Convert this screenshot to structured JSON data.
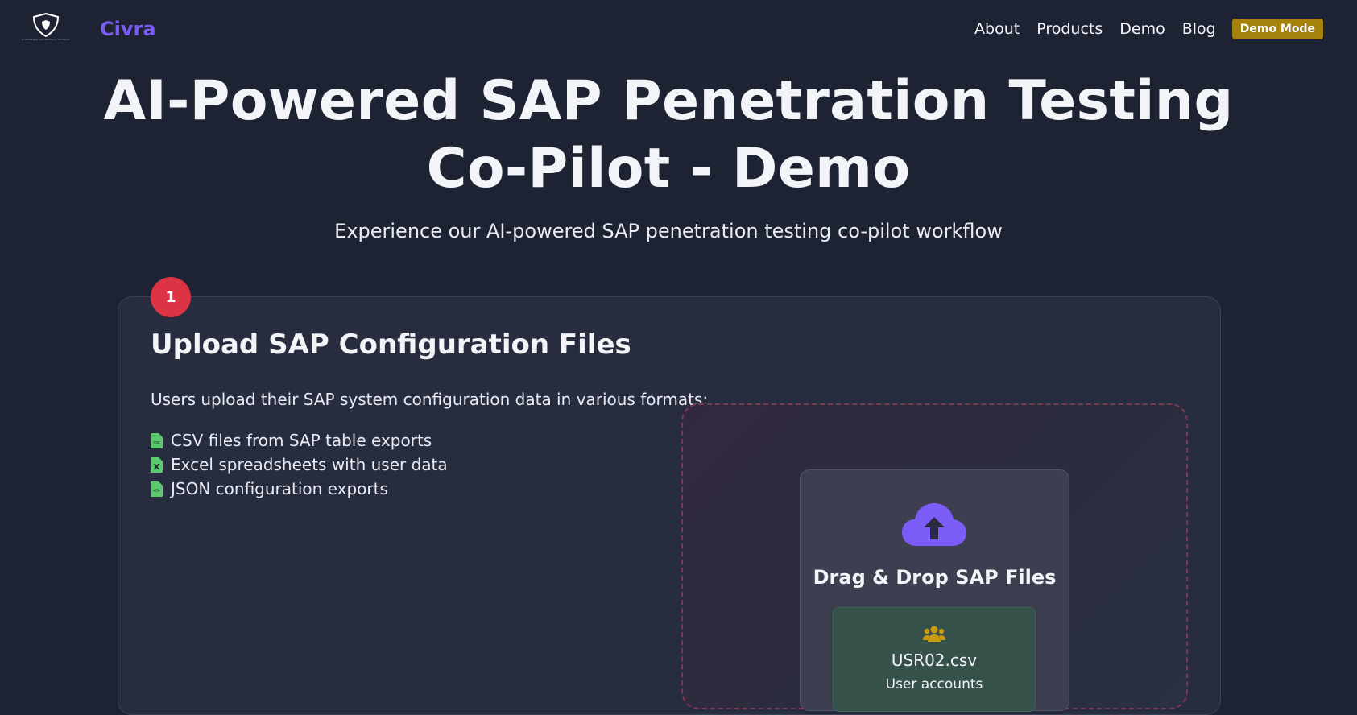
{
  "header": {
    "logo_text": "CIVRA",
    "logo_tagline": "AI POWERED SAP SECURITY CO-PILOT",
    "brand_name": "Civra",
    "nav": [
      {
        "label": "About"
      },
      {
        "label": "Products"
      },
      {
        "label": "Demo"
      },
      {
        "label": "Blog"
      }
    ],
    "demo_badge": "Demo Mode"
  },
  "hero": {
    "title": "AI-Powered SAP Penetration Testing Co-Pilot - Demo",
    "subtitle": "Experience our AI-powered SAP penetration testing co-pilot workflow"
  },
  "step": {
    "number": "1",
    "title": "Upload SAP Configuration Files",
    "description": "Users upload their SAP system configuration data in various formats:",
    "formats": [
      {
        "label": "CSV files from SAP table exports",
        "icon": "csv-file-icon",
        "glyph": "csv"
      },
      {
        "label": "Excel spreadsheets with user data",
        "icon": "excel-file-icon",
        "glyph": "X"
      },
      {
        "label": "JSON configuration exports",
        "icon": "json-file-icon",
        "glyph": "<>"
      }
    ]
  },
  "upload": {
    "drop_title": "Drag & Drop SAP Files",
    "file": {
      "name": "USR02.csv",
      "description": "User accounts",
      "icon": "users-icon"
    }
  },
  "colors": {
    "background": "#1e2334",
    "brand": "#7b5cf6",
    "badge": "#a4820b",
    "step_badge": "#de3345",
    "file_icon": "#5cc96e",
    "users_icon": "#c79a12"
  }
}
